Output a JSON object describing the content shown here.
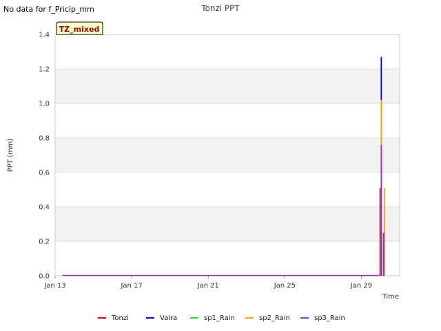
{
  "note": "No data for f_Pricip_mm",
  "badge": "TZ_mixed",
  "colors": {
    "Tonzi": "#cc0000",
    "Vaira": "#0000cc",
    "sp1_Rain": "#22dd22",
    "sp2_Rain": "#ffa500",
    "sp3_Rain": "#9932cc",
    "band": "#f2f2f2",
    "badge_bg": "#ffffcc",
    "badge_text": "#990000"
  },
  "chart_data": {
    "type": "bar",
    "title": "Tonzi PPT",
    "xlabel": "Time",
    "ylabel": "PPT (mm)",
    "ylim": [
      0,
      1.4
    ],
    "xlim": [
      "2024-01-13",
      "2024-01-31"
    ],
    "x_ticks": [
      {
        "label": "Jan 13",
        "date": "2024-01-13"
      },
      {
        "label": "Jan 17",
        "date": "2024-01-17"
      },
      {
        "label": "Jan 21",
        "date": "2024-01-21"
      },
      {
        "label": "Jan 25",
        "date": "2024-01-25"
      },
      {
        "label": "Jan 29",
        "date": "2024-01-29"
      }
    ],
    "y_ticks": [
      "0.0",
      "0.2",
      "0.4",
      "0.6",
      "0.8",
      "1.0",
      "1.2",
      "1.4"
    ],
    "grid": true,
    "legend_position": "bottom",
    "baseline": {
      "series": "sp3_Rain",
      "from": "2024-01-13T09:00",
      "to": "2024-01-30T00:00",
      "value": 0
    },
    "series": [
      {
        "name": "Tonzi",
        "points": []
      },
      {
        "name": "Vaira",
        "points": [
          {
            "t": "2024-01-30T01:00",
            "v": 1.27
          }
        ]
      },
      {
        "name": "sp1_Rain",
        "points": [
          {
            "t": "2024-01-30T01:00",
            "v": 1.01
          }
        ]
      },
      {
        "name": "sp2_Rain",
        "points": [
          {
            "t": "2024-01-29T23:00",
            "v": 0.51
          },
          {
            "t": "2024-01-30T01:00",
            "v": 1.02
          },
          {
            "t": "2024-01-30T05:00",
            "v": 0.51
          }
        ]
      },
      {
        "name": "sp3_Rain",
        "points": [
          {
            "t": "2024-01-30T00:00",
            "v": 0.51
          },
          {
            "t": "2024-01-30T00:30",
            "v": 0.25
          },
          {
            "t": "2024-01-30T01:00",
            "v": 0.76
          },
          {
            "t": "2024-01-30T01:30",
            "v": 0.25
          },
          {
            "t": "2024-01-30T04:00",
            "v": 0.25
          }
        ]
      }
    ]
  }
}
